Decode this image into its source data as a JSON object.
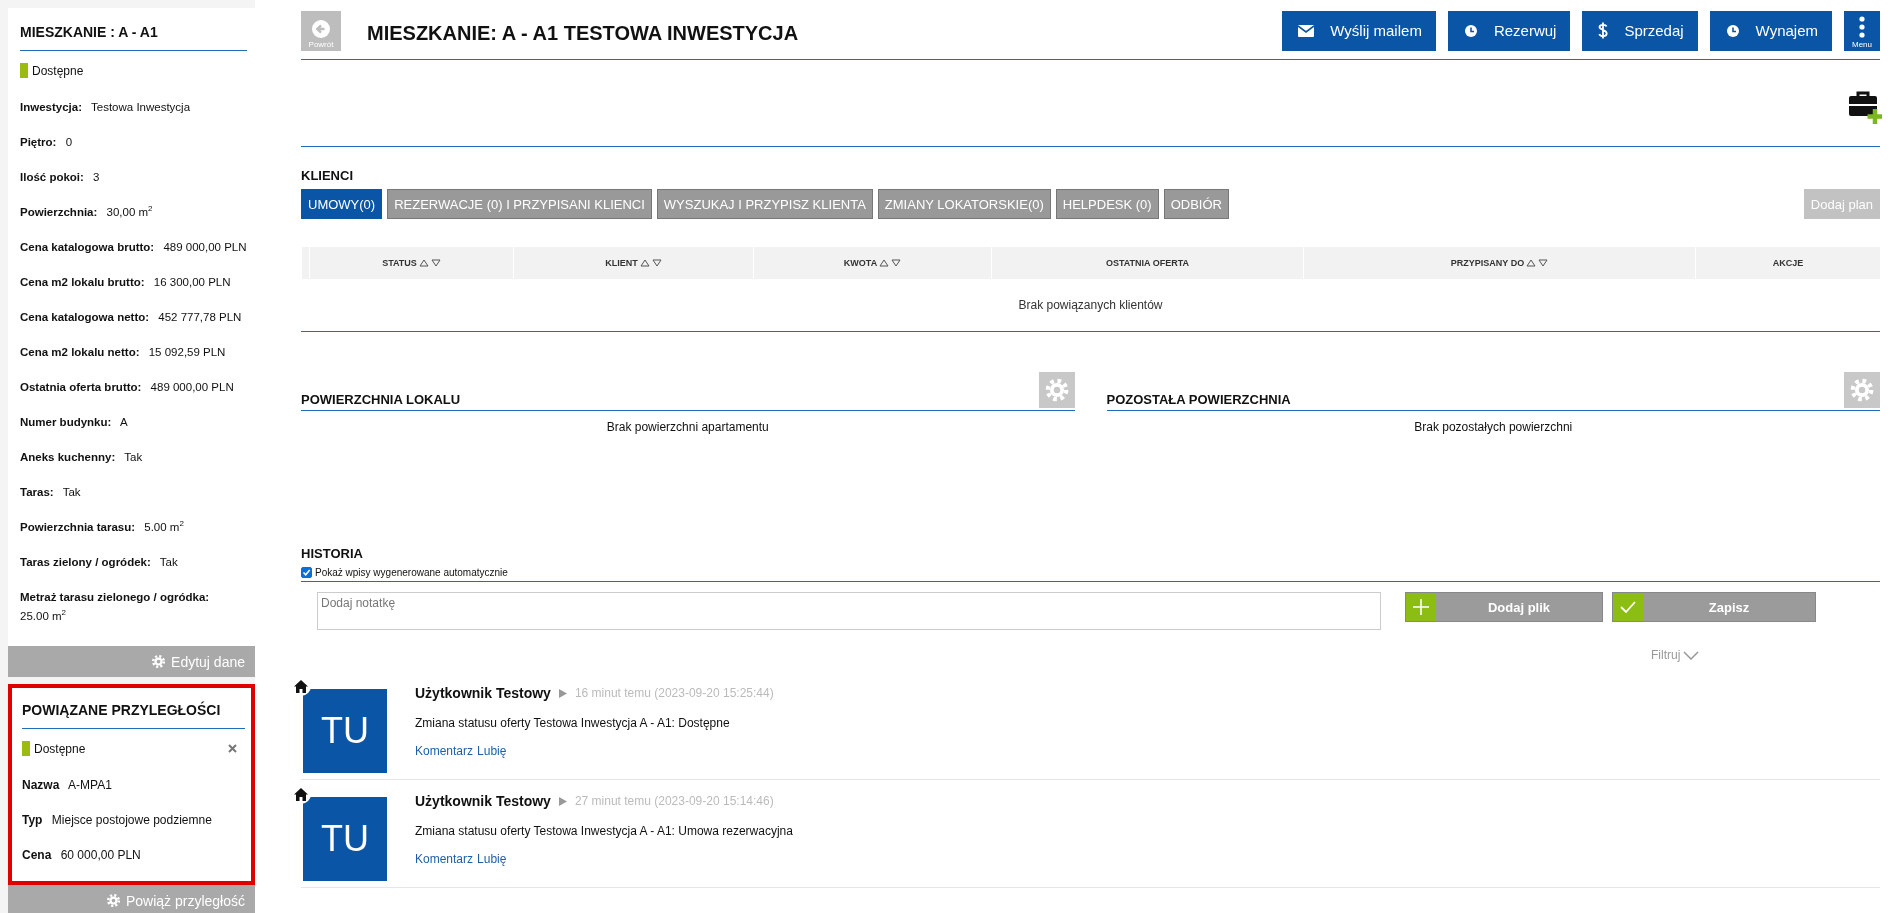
{
  "sidebar": {
    "title": "MIESZKANIE : A - A1",
    "status": {
      "label": "Dostępne",
      "color": "#9bbb0e"
    },
    "fields": [
      {
        "label": "Inwestycja:",
        "value": "Testowa Inwestycja"
      },
      {
        "label": "Piętro:",
        "value": "0"
      },
      {
        "label": "Ilość pokoi:",
        "value": "3"
      },
      {
        "label": "Powierzchnia:",
        "value": "30,00 m$^{2}$"
      },
      {
        "label": "Cena katalogowa brutto:",
        "value": "489 000,00 PLN"
      },
      {
        "label": "Cena m2 lokalu brutto:",
        "value": "16 300,00 PLN"
      },
      {
        "label": "Cena katalogowa netto:",
        "value": "452 777,78 PLN"
      },
      {
        "label": "Cena m2 lokalu netto:",
        "value": "15 092,59 PLN"
      },
      {
        "label": "Ostatnia oferta brutto:",
        "value": "489 000,00 PLN"
      },
      {
        "label": "Numer budynku:",
        "value": "A"
      },
      {
        "label": "Aneks kuchenny:",
        "value": "Tak"
      },
      {
        "label": "Taras:",
        "value": "Tak"
      },
      {
        "label": "Powierzchnia tarasu:",
        "value": "5.00 m$^{2}$"
      },
      {
        "label": "Taras zielony / ogródek:",
        "value": "Tak"
      },
      {
        "label": "Metraż tarasu zielonego / ogródka:",
        "value": "25.00 m$^{2}$"
      }
    ],
    "button": "Edytuj dane"
  },
  "adjacent": {
    "title": "POWIĄZANE PRZYLEGŁOŚCI",
    "status": {
      "label": "Dostępne",
      "color": "#9bbb0e"
    },
    "fields": [
      {
        "label": "Nazwa",
        "value": "A-MPA1"
      },
      {
        "label": "Typ",
        "value": "Miejsce postojowe podziemne"
      },
      {
        "label": "Cena",
        "value": "60 000,00 PLN"
      }
    ],
    "button": "Powiąż przyległość"
  },
  "header": {
    "back_label": "Powrót",
    "title": "MIESZKANIE: A - A1 TESTOWA INWESTYCJA",
    "actions": [
      {
        "label": "Wyślij mailem",
        "kind": "mail"
      },
      {
        "label": "Rezerwuj",
        "kind": "booking"
      },
      {
        "label": "Sprzedaj",
        "kind": "sale"
      },
      {
        "label": "Wynajem",
        "kind": "rent"
      }
    ],
    "menu_label": "Menu"
  },
  "clients": {
    "title": "KLIENCI",
    "tabs": [
      {
        "label": "UMOWY(0)",
        "selected": true
      },
      {
        "label": "REZERWACJE (0) I PRZYPISANI KLIENCI",
        "selected": false
      },
      {
        "label": "WYSZUKAJ I PRZYPISZ KLIENTA",
        "selected": false
      },
      {
        "label": "ZMIANY LOKATORSKIE(0)",
        "selected": false
      },
      {
        "label": "HELPDESK (0)",
        "selected": false
      },
      {
        "label": "ODBIÓR",
        "selected": false
      }
    ],
    "add_plan": {
      "label": "Dodaj plan",
      "disabled": true
    },
    "columns": [
      {
        "label": "STATUS",
        "sortable": true
      },
      {
        "label": "KLIENT",
        "sortable": true
      },
      {
        "label": "KWOTA",
        "sortable": true
      },
      {
        "label": "OSTATNIA OFERTA",
        "sortable": false
      },
      {
        "label": "PRZYPISANY DO",
        "sortable": true
      },
      {
        "label": "AKCJE",
        "sortable": false
      }
    ],
    "empty": "Brak powiązanych klientów"
  },
  "surfaces": [
    {
      "title": "POWIERZCHNIA LOKALU",
      "empty": "Brak powierzchni apartamentu"
    },
    {
      "title": "POZOSTAŁA POWIERZCHNIA",
      "empty": "Brak pozostałych powierzchni"
    }
  ],
  "history": {
    "title": "HISTORIA",
    "auto_entries": {
      "label": "Pokaż wpisy wygenerowane automatycznie",
      "checked": true
    },
    "note_placeholder": "Dodaj notatkę",
    "add_file": "Dodaj plik",
    "save": "Zapisz",
    "filter": "Filtruj",
    "entries": [
      {
        "initials": "TU",
        "user": "Użytkownik Testowy",
        "time": "16 minut temu (2023-09-20 15:25:44)",
        "text": "Zmiana statusu oferty Testowa Inwestycja A - A1: Dostępne",
        "links": [
          "Komentarz",
          "Lubię"
        ]
      },
      {
        "initials": "TU",
        "user": "Użytkownik Testowy",
        "time": "27 minut temu (2023-09-20 15:14:46)",
        "text": "Zmiana statusu oferty Testowa Inwestycja A - A1: Umowa rezerwacyjna",
        "links": [
          "Komentarz",
          "Lubię"
        ]
      }
    ]
  }
}
